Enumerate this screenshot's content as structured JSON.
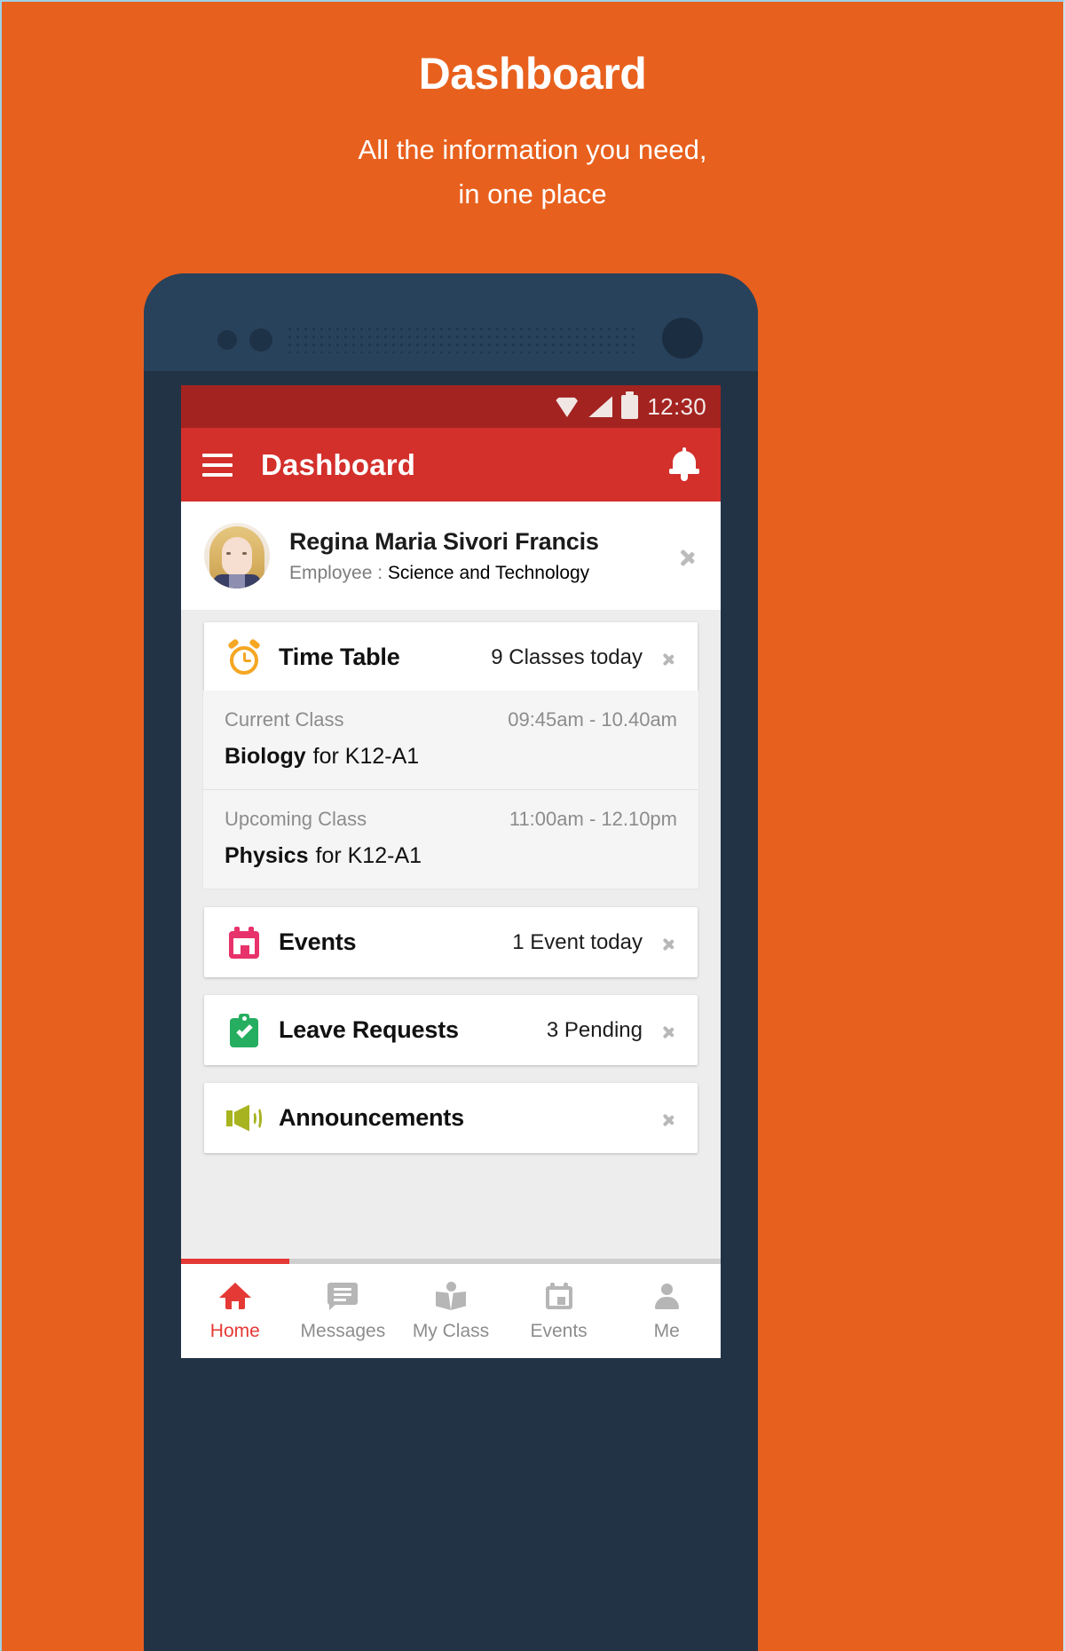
{
  "promo": {
    "title": "Dashboard",
    "subtitle_line1": "All the information you need,",
    "subtitle_line2": "in one place"
  },
  "colors": {
    "background_orange": "#E8601D",
    "app_bar_red": "#D32F2B",
    "status_bar_red": "#A32320",
    "accent_red": "#E53935",
    "alarm_orange": "#F5A623",
    "calendar_pink": "#E8326B",
    "clipboard_green": "#26AE60",
    "speaker_olive": "#A8B320",
    "phone_frame": "#223346"
  },
  "status_bar": {
    "time": "12:30",
    "icons": [
      "wifi-icon",
      "signal-icon",
      "battery-icon"
    ]
  },
  "app_bar": {
    "menu_icon": "hamburger-menu-icon",
    "title": "Dashboard",
    "notification_icon": "bell-icon"
  },
  "profile": {
    "avatar": "user-avatar",
    "name": "Regina Maria Sivori Francis",
    "role_label": "Employee :",
    "role_value": "Science and Technology",
    "chevron": "chevron-right-icon"
  },
  "cards": {
    "time_table": {
      "icon": "alarm-clock-icon",
      "title": "Time Table",
      "meta": "9 Classes today",
      "chevron": "chevron-right-icon"
    },
    "classes": [
      {
        "label": "Current Class",
        "time": "09:45am - 10.40am",
        "subject": "Biology",
        "section": "for K12-A1"
      },
      {
        "label": "Upcoming Class",
        "time": "11:00am - 12.10pm",
        "subject": "Physics",
        "section": "for K12-A1"
      }
    ],
    "events": {
      "icon": "calendar-icon",
      "title": "Events",
      "meta": "1 Event today",
      "chevron": "chevron-right-icon"
    },
    "leave_requests": {
      "icon": "clipboard-check-icon",
      "title": "Leave Requests",
      "meta": "3 Pending",
      "chevron": "chevron-right-icon"
    },
    "announcements": {
      "icon": "speaker-icon",
      "title": "Announcements",
      "meta": "",
      "chevron": "chevron-right-icon"
    }
  },
  "bottom_nav": {
    "items": [
      {
        "label": "Home",
        "icon": "home-icon",
        "active": true
      },
      {
        "label": "Messages",
        "icon": "message-icon",
        "active": false
      },
      {
        "label": "My Class",
        "icon": "book-icon",
        "active": false
      },
      {
        "label": "Events",
        "icon": "calendar-icon",
        "active": false
      },
      {
        "label": "Me",
        "icon": "person-icon",
        "active": false
      }
    ]
  }
}
